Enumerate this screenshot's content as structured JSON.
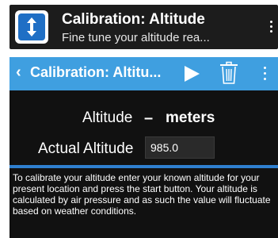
{
  "card": {
    "title": "Calibration: Altitude",
    "subtitle": "Fine tune your altitude rea...",
    "icon": "vertical-arrows-icon"
  },
  "toolbar": {
    "back_glyph": "‹",
    "title": "Calibration: Altitu...",
    "background": "#3f9fe0"
  },
  "altitude": {
    "label": "Altitude",
    "value": "–",
    "units": "meters"
  },
  "actual": {
    "label": "Actual Altitude",
    "value": "985.0"
  },
  "help_text": "To calibrate your altitude enter your known altitude for your present location and press the start button. Your altitude is calculated by air pressure and as such the value will fluctuate based on weather conditions."
}
